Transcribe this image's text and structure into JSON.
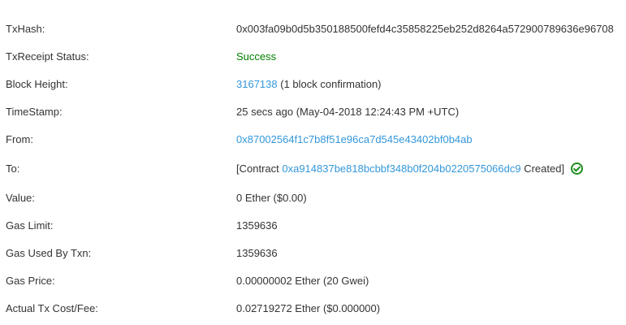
{
  "rows": {
    "txhash": {
      "label": "TxHash:",
      "value": "0x003fa09b0d5b350188500fefd4c35858225eb252d8264a572900789636e96708"
    },
    "status": {
      "label": "TxReceipt Status:",
      "value": "Success"
    },
    "block": {
      "label": "Block Height:",
      "link": "3167138",
      "suffix": " (1 block confirmation)"
    },
    "timestamp": {
      "label": "TimeStamp:",
      "value": "25 secs ago (May-04-2018 12:24:43 PM +UTC)"
    },
    "from": {
      "label": "From:",
      "link": "0x87002564f1c7b8f51e96ca7d545e43402bf0b4ab"
    },
    "to": {
      "label": "To:",
      "prefix": "[Contract ",
      "link": "0xa914837be818bcbbf348b0f204b0220575066dc9",
      "suffix": " Created]",
      "icon": "check-circle-icon"
    },
    "value": {
      "label": "Value:",
      "value": "0 Ether ($0.00)"
    },
    "gas_limit": {
      "label": "Gas Limit:",
      "value": "1359636"
    },
    "gas_used": {
      "label": "Gas Used By Txn:",
      "value": "1359636"
    },
    "gas_price": {
      "label": "Gas Price:",
      "value": "0.00000002 Ether (20 Gwei)"
    },
    "fee": {
      "label": "Actual Tx Cost/Fee:",
      "value": "0.02719272 Ether ($0.000000)"
    }
  },
  "colors": {
    "link": "#3498db",
    "success": "#008000"
  }
}
